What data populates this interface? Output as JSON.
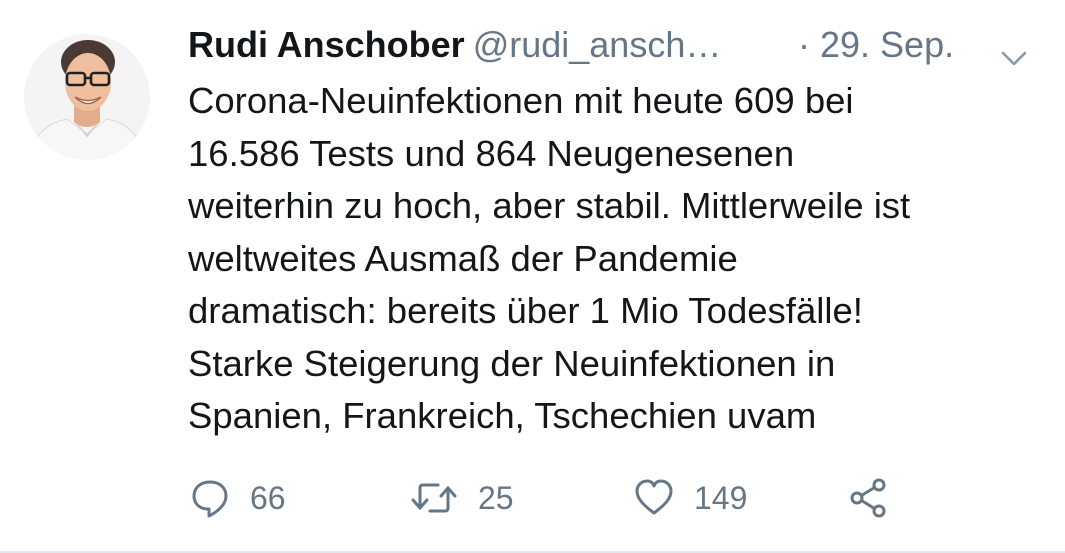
{
  "tweet": {
    "author_name": "Rudi Anschober",
    "handle": "@rudi_ansch…",
    "date": "· 29. Sep.",
    "text": "Corona-Neuinfektionen mit heute 609 bei\n16.586 Tests und 864 Neugenesenen\nweiterhin zu hoch, aber stabil. Mittlerweile ist\nweltweites Ausmaß der Pandemie\ndramatisch: bereits über 1 Mio Todesfälle!\nStarke Steigerung der Neuinfektionen in\nSpanien, Frankreich, Tschechien uvam",
    "reply_count": "66",
    "retweet_count": "25",
    "like_count": "149"
  },
  "icons": {
    "menu": "chevron-down-icon",
    "reply": "speech-bubble-icon",
    "retweet": "retweet-arrows-icon",
    "like": "heart-outline-icon",
    "share": "share-nodes-icon"
  },
  "colors": {
    "text": "#14171a",
    "secondary": "#657786",
    "divider": "#e1e8ed"
  }
}
